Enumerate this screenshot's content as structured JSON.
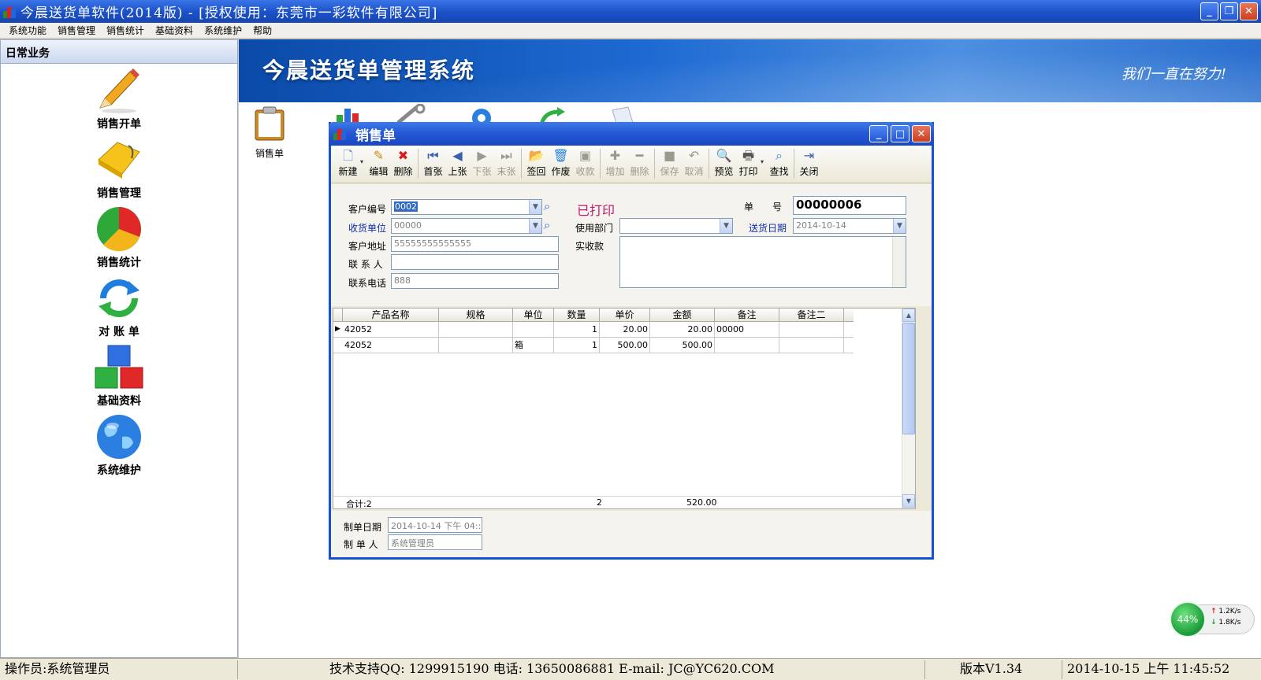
{
  "window": {
    "title": "今晨送货单软件(2014版) - [授权使用：东莞市一彩软件有限公司]"
  },
  "menu": [
    "系统功能",
    "销售管理",
    "销售统计",
    "基础资料",
    "系统维护",
    "帮助"
  ],
  "sidebar": {
    "header": "日常业务",
    "items": [
      {
        "label": "销售开单",
        "icon": "pencil-icon"
      },
      {
        "label": "销售管理",
        "icon": "folder-icon"
      },
      {
        "label": "销售统计",
        "icon": "pie-chart-icon"
      },
      {
        "label": "对 账 单",
        "icon": "refresh-arrows-icon"
      },
      {
        "label": "基础资料",
        "icon": "blocks-icon"
      },
      {
        "label": "系统维护",
        "icon": "globe-icon"
      }
    ]
  },
  "banner": {
    "title": "今晨送货单管理系统",
    "slogan": "我们一直在努力!"
  },
  "quick_items": [
    {
      "label": "销售单",
      "icon": "clipboard-icon"
    }
  ],
  "dialog": {
    "title": "销售单",
    "toolbar": [
      {
        "label": "新建",
        "icon": "new-doc-icon",
        "enabled": true
      },
      {
        "label": "编辑",
        "icon": "edit-icon",
        "enabled": true
      },
      {
        "label": "删除",
        "icon": "delete-icon",
        "enabled": true
      },
      {
        "label": "首张",
        "icon": "first-icon",
        "enabled": true
      },
      {
        "label": "上张",
        "icon": "prev-icon",
        "enabled": true
      },
      {
        "label": "下张",
        "icon": "next-icon",
        "enabled": false
      },
      {
        "label": "末张",
        "icon": "last-icon",
        "enabled": false
      },
      {
        "label": "签回",
        "icon": "sign-back-icon",
        "enabled": true
      },
      {
        "label": "作废",
        "icon": "void-icon",
        "enabled": true
      },
      {
        "label": "收款",
        "icon": "receive-icon",
        "enabled": false
      },
      {
        "label": "增加",
        "icon": "add-icon",
        "enabled": false
      },
      {
        "label": "删除",
        "icon": "remove-icon",
        "enabled": false
      },
      {
        "label": "保存",
        "icon": "save-icon",
        "enabled": false
      },
      {
        "label": "取消",
        "icon": "cancel-icon",
        "enabled": false
      },
      {
        "label": "预览",
        "icon": "preview-icon",
        "enabled": true
      },
      {
        "label": "打印",
        "icon": "print-icon",
        "enabled": true
      },
      {
        "label": "查找",
        "icon": "find-icon",
        "enabled": true
      },
      {
        "label": "关闭",
        "icon": "close-door-icon",
        "enabled": true
      }
    ],
    "form": {
      "customer_code_label": "客户编号",
      "customer_code": "0002",
      "receiver_label": "收货单位",
      "receiver": "00000",
      "address_label": "客户地址",
      "address": "55555555555555",
      "contact_label": "联 系 人",
      "contact": "",
      "phone_label": "联系电话",
      "phone": "888",
      "status": "已打印",
      "bill_no_label": "单　　号",
      "bill_no": "00000006",
      "dept_label": "使用部门",
      "dept": "",
      "delivery_date_label": "送货日期",
      "delivery_date": "2014-10-14",
      "paid_label": "实收款"
    },
    "grid": {
      "columns": [
        "产品名称",
        "规格",
        "单位",
        "数量",
        "单价",
        "金额",
        "备注",
        "备注二"
      ],
      "rows": [
        {
          "name": "42052",
          "spec": "",
          "unit": "",
          "qty": "1",
          "price": "20.00",
          "amount": "20.00",
          "note": "00000",
          "note2": ""
        },
        {
          "name": "42052",
          "spec": "",
          "unit": "箱",
          "qty": "1",
          "price": "500.00",
          "amount": "500.00",
          "note": "",
          "note2": ""
        }
      ],
      "footer": {
        "count_label": "合计:2",
        "total_qty": "2",
        "total_amount": "520.00"
      }
    },
    "meta": {
      "made_date_label": "制单日期",
      "made_date": "2014-10-14 下午 04::",
      "maker_label": "制 单 人",
      "maker": "系统管理员"
    }
  },
  "status_bar": {
    "operator": "操作员:系统管理员",
    "support": "技术支持QQ: 1299915190  电话: 13650086881  E-mail: JC@YC620.COM",
    "version": "版本V1.34",
    "datetime": "2014-10-15 上午 11:45:52"
  },
  "network": {
    "percent": "44%",
    "up": "1.2K/s",
    "down": "1.8K/s"
  },
  "colors": {
    "title_blue": "#1a50c8",
    "printed_status": "#c0186a",
    "label_blue": "#0e2fb0"
  }
}
